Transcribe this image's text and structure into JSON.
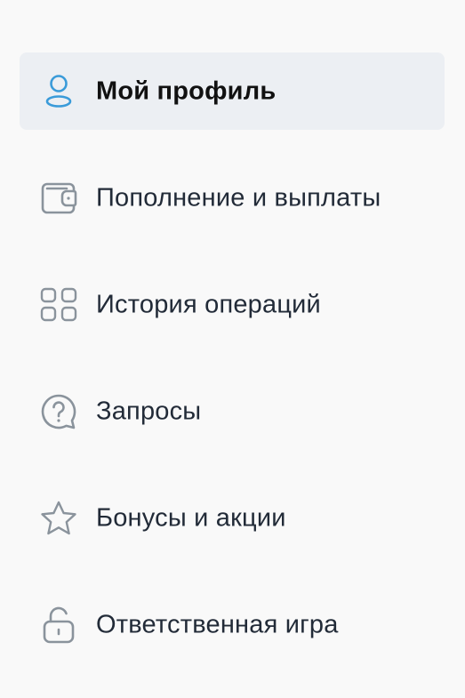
{
  "menu": {
    "items": [
      {
        "label": "Мой профиль",
        "icon": "user-icon",
        "active": true
      },
      {
        "label": "Пополнение и выплаты",
        "icon": "wallet-icon",
        "active": false
      },
      {
        "label": "История операций",
        "icon": "grid-icon",
        "active": false
      },
      {
        "label": "Запросы",
        "icon": "question-bubble-icon",
        "active": false
      },
      {
        "label": "Бонусы и акции",
        "icon": "star-icon",
        "active": false
      },
      {
        "label": "Ответственная игра",
        "icon": "unlock-icon",
        "active": false
      }
    ]
  },
  "colors": {
    "background": "#f9f9f9",
    "active_background": "#eceff3",
    "active_icon": "#3a9bd9",
    "icon": "#8a939c",
    "text": "#222b38"
  }
}
